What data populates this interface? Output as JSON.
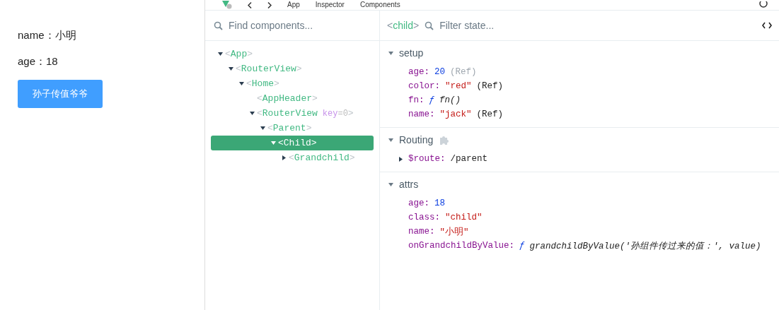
{
  "page": {
    "lines": [
      "name：小明",
      "age：18"
    ],
    "button": "孙子传值爷爷"
  },
  "toolbar": {
    "crumbs": [
      "App",
      "Inspector",
      "Components"
    ]
  },
  "tree": {
    "search_placeholder": "Find components...",
    "nodes": [
      {
        "open": "<",
        "name": "App",
        "close": ">",
        "expanded": true,
        "selected": false,
        "children": [
          {
            "open": "<",
            "name": "RouterView",
            "close": ">",
            "expanded": true,
            "selected": false,
            "children": [
              {
                "open": "<",
                "name": "Home",
                "close": ">",
                "expanded": true,
                "selected": false,
                "children": [
                  {
                    "open": "<",
                    "name": "AppHeader",
                    "close": ">",
                    "selected": false
                  },
                  {
                    "open": "<",
                    "name": "RouterView",
                    "attr_key": "key",
                    "attr_value": "=0",
                    "close": ">",
                    "expanded": true,
                    "selected": false,
                    "children": [
                      {
                        "open": "<",
                        "name": "Parent",
                        "close": ">",
                        "expanded": true,
                        "selected": false,
                        "children": [
                          {
                            "open": "<",
                            "name": "Child",
                            "close": ">",
                            "expanded": true,
                            "selected": true,
                            "children": [
                              {
                                "open": "<",
                                "name": "Grandchild",
                                "close": ">",
                                "expanded": false,
                                "selected": false
                              }
                            ]
                          }
                        ]
                      }
                    ]
                  }
                ]
              }
            ]
          }
        ]
      }
    ]
  },
  "state": {
    "component": {
      "open": "<",
      "name": "child",
      "close": ">"
    },
    "filter_placeholder": "Filter state...",
    "sections": [
      {
        "title": "setup",
        "expanded": true,
        "plugin": false,
        "rows": [
          {
            "parts": [
              {
                "kind": "key",
                "text": "age:"
              },
              {
                "kind": "number",
                "text": "20"
              },
              {
                "kind": "muted",
                "text": "(Ref)"
              }
            ]
          },
          {
            "parts": [
              {
                "kind": "key",
                "text": "color:"
              },
              {
                "kind": "string",
                "text": "\"red\""
              },
              {
                "kind": "plain",
                "text": "(Ref)"
              }
            ]
          },
          {
            "parts": [
              {
                "kind": "key",
                "text": "fn:"
              },
              {
                "kind": "func",
                "text": "ƒ"
              },
              {
                "kind": "italic",
                "text": "fn()"
              }
            ]
          },
          {
            "parts": [
              {
                "kind": "key",
                "text": "name:"
              },
              {
                "kind": "string",
                "text": "\"jack\""
              },
              {
                "kind": "plain",
                "text": "(Ref)"
              }
            ]
          }
        ]
      },
      {
        "title": "Routing",
        "expanded": true,
        "plugin": true,
        "rows": [
          {
            "expanded": false,
            "parts": [
              {
                "kind": "key",
                "text": "$route:"
              },
              {
                "kind": "plain",
                "text": "/parent"
              }
            ]
          }
        ]
      },
      {
        "title": "attrs",
        "expanded": true,
        "plugin": false,
        "rows": [
          {
            "parts": [
              {
                "kind": "key",
                "text": "age:"
              },
              {
                "kind": "number",
                "text": "18"
              }
            ]
          },
          {
            "parts": [
              {
                "kind": "key",
                "text": "class:"
              },
              {
                "kind": "string",
                "text": "\"child\""
              }
            ]
          },
          {
            "parts": [
              {
                "kind": "key",
                "text": "name:"
              },
              {
                "kind": "string",
                "text": "\"小明\""
              }
            ]
          },
          {
            "parts": [
              {
                "kind": "key",
                "text": "onGrandchildByValue:"
              },
              {
                "kind": "func",
                "text": "ƒ"
              },
              {
                "kind": "italic",
                "text": "grandchildByValue('孙组件传过来的值：', value)"
              }
            ]
          }
        ]
      }
    ]
  }
}
